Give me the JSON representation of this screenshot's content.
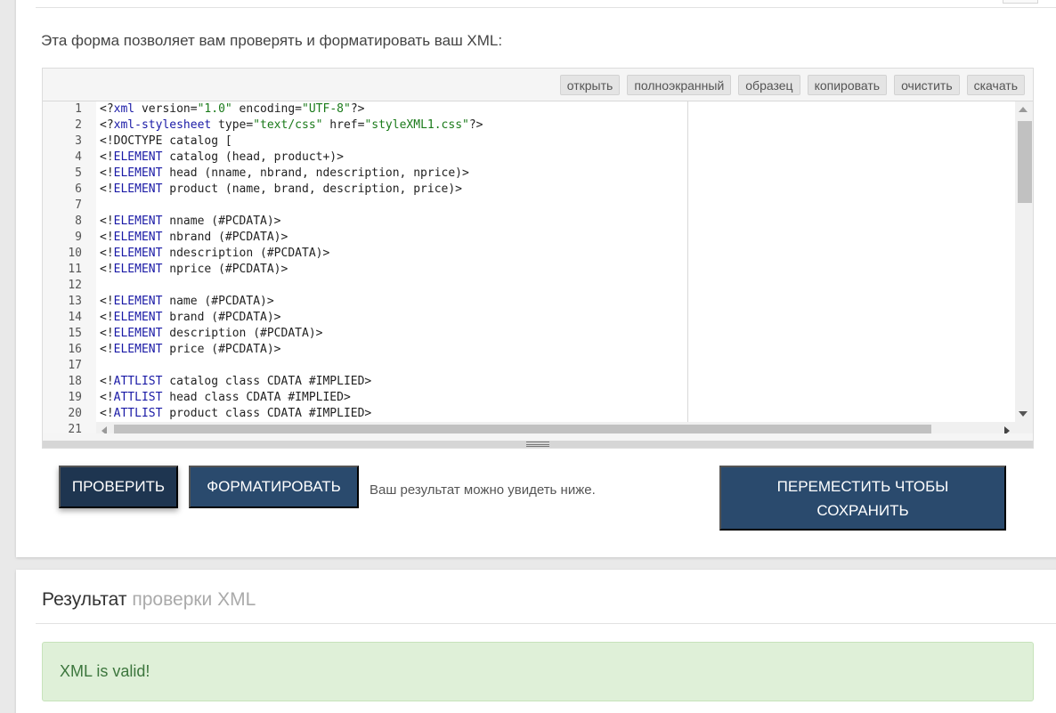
{
  "form": {
    "intro_text": "Эта форма позволяет вам проверять и форматировать ваш XML:"
  },
  "toolbar": {
    "open_label": "открыть",
    "fullscreen_label": "полноэкранный",
    "sample_label": "образец",
    "copy_label": "копировать",
    "clear_label": "очистить",
    "download_label": "скачать"
  },
  "editor": {
    "line_numbers": [
      "1",
      "2",
      "3",
      "4",
      "5",
      "6",
      "7",
      "8",
      "9",
      "10",
      "11",
      "12",
      "13",
      "14",
      "15",
      "16",
      "17",
      "18",
      "19",
      "20",
      "21"
    ],
    "lines": [
      [
        [
          "b",
          "<?"
        ],
        [
          "k",
          "xml"
        ],
        [
          "p",
          " version="
        ],
        [
          "s",
          "\"1.0\""
        ],
        [
          "p",
          " encoding="
        ],
        [
          "s",
          "\"UTF-8\""
        ],
        [
          "b",
          "?>"
        ]
      ],
      [
        [
          "b",
          "<?"
        ],
        [
          "k",
          "xml-stylesheet"
        ],
        [
          "p",
          " type="
        ],
        [
          "s",
          "\"text/css\""
        ],
        [
          "p",
          " href="
        ],
        [
          "s",
          "\"styleXML1.css\""
        ],
        [
          "b",
          "?>"
        ]
      ],
      [
        [
          "b",
          "<!"
        ],
        [
          "p",
          "DOCTYPE "
        ],
        [
          "p",
          "catalog ["
        ]
      ],
      [
        [
          "b",
          "<!"
        ],
        [
          "k",
          "ELEMENT"
        ],
        [
          "p",
          " catalog (head, product+)>"
        ]
      ],
      [
        [
          "b",
          "<!"
        ],
        [
          "k",
          "ELEMENT"
        ],
        [
          "p",
          " head (nname, nbrand, ndescription, nprice)>"
        ]
      ],
      [
        [
          "b",
          "<!"
        ],
        [
          "k",
          "ELEMENT"
        ],
        [
          "p",
          " product (name, brand, description, price)>"
        ]
      ],
      [],
      [
        [
          "b",
          "<!"
        ],
        [
          "k",
          "ELEMENT"
        ],
        [
          "p",
          " nname (#PCDATA)>"
        ]
      ],
      [
        [
          "b",
          "<!"
        ],
        [
          "k",
          "ELEMENT"
        ],
        [
          "p",
          " nbrand (#PCDATA)>"
        ]
      ],
      [
        [
          "b",
          "<!"
        ],
        [
          "k",
          "ELEMENT"
        ],
        [
          "p",
          " ndescription (#PCDATA)>"
        ]
      ],
      [
        [
          "b",
          "<!"
        ],
        [
          "k",
          "ELEMENT"
        ],
        [
          "p",
          " nprice (#PCDATA)>"
        ]
      ],
      [],
      [
        [
          "b",
          "<!"
        ],
        [
          "k",
          "ELEMENT"
        ],
        [
          "p",
          " name (#PCDATA)>"
        ]
      ],
      [
        [
          "b",
          "<!"
        ],
        [
          "k",
          "ELEMENT"
        ],
        [
          "p",
          " brand (#PCDATA)>"
        ]
      ],
      [
        [
          "b",
          "<!"
        ],
        [
          "k",
          "ELEMENT"
        ],
        [
          "p",
          " description (#PCDATA)>"
        ]
      ],
      [
        [
          "b",
          "<!"
        ],
        [
          "k",
          "ELEMENT"
        ],
        [
          "p",
          " price (#PCDATA)>"
        ]
      ],
      [],
      [
        [
          "b",
          "<!"
        ],
        [
          "k",
          "ATTLIST"
        ],
        [
          "p",
          " catalog class CDATA #IMPLIED>"
        ]
      ],
      [
        [
          "b",
          "<!"
        ],
        [
          "k",
          "ATTLIST"
        ],
        [
          "p",
          " head class CDATA #IMPLIED>"
        ]
      ],
      [
        [
          "b",
          "<!"
        ],
        [
          "k",
          "ATTLIST"
        ],
        [
          "p",
          " product class CDATA #IMPLIED>"
        ]
      ]
    ]
  },
  "actions": {
    "check_label": "ПРОВЕРИТЬ",
    "format_label": "ФОРМАТИРОВАТЬ",
    "hint_text": "Ваш результат можно увидеть ниже.",
    "move_label": "ПЕРЕМЕСТИТЬ ЧТОБЫ СОХРАНИТЬ"
  },
  "result": {
    "title_main": "Результат",
    "title_muted": "проверки XML",
    "message": "XML is valid!"
  },
  "colors": {
    "primary_dark": "#1e3550",
    "primary": "#2a4a6d",
    "success_bg": "#dff0d8",
    "success_text": "#3c763d",
    "xml_keyword": "#1a1aa6",
    "xml_string": "#1a7a1a"
  }
}
